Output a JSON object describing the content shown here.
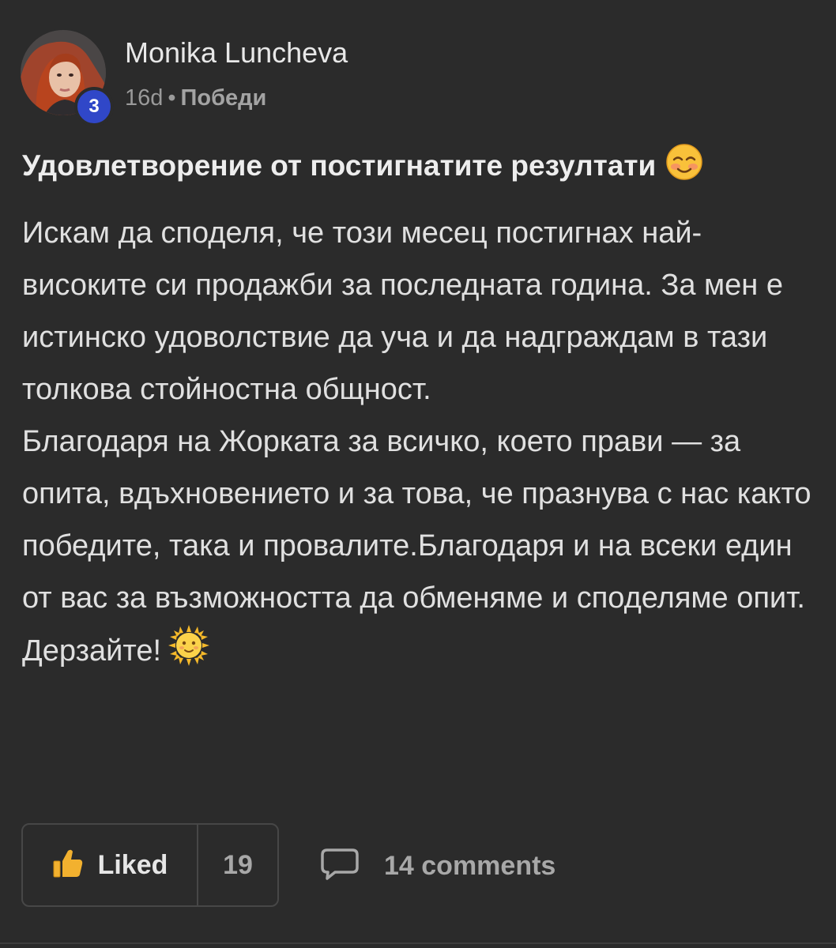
{
  "author": {
    "name": "Monika Luncheva",
    "level": "3"
  },
  "meta": {
    "time_ago": "16d",
    "separator": "•",
    "category": "Победи"
  },
  "post": {
    "title": "Удовлетворение от постигнатите резултати",
    "title_emoji": "smiling-face-icon",
    "paragraphs": [
      "Искам да споделя, че този месец постигнах най-високите си продажби за последната година. За мен е истинско удоволствие да уча и да надграждам в тази толкова стойностна общност.",
      "Благодаря на Жорката за всичко, което прави — за опита, вдъхновението и за това, че празнува с нас както победите, така и провалите.Благодаря и на всеки един от вас за възможността да обменяме и споделяме опит.",
      "Дерзайте!"
    ],
    "closing_emoji": "sun-with-face-icon"
  },
  "actions": {
    "like_label": "Liked",
    "like_count": "19",
    "comments_label": "14 comments",
    "like_icon": "thumbs-up-icon",
    "comment_icon": "comment-bubble-icon"
  },
  "colors": {
    "background": "#2b2b2b",
    "level_badge": "#3047c8",
    "like_icon": "#f2b12f",
    "text_primary": "#e4e4e4",
    "text_muted": "#9a9a9a"
  }
}
